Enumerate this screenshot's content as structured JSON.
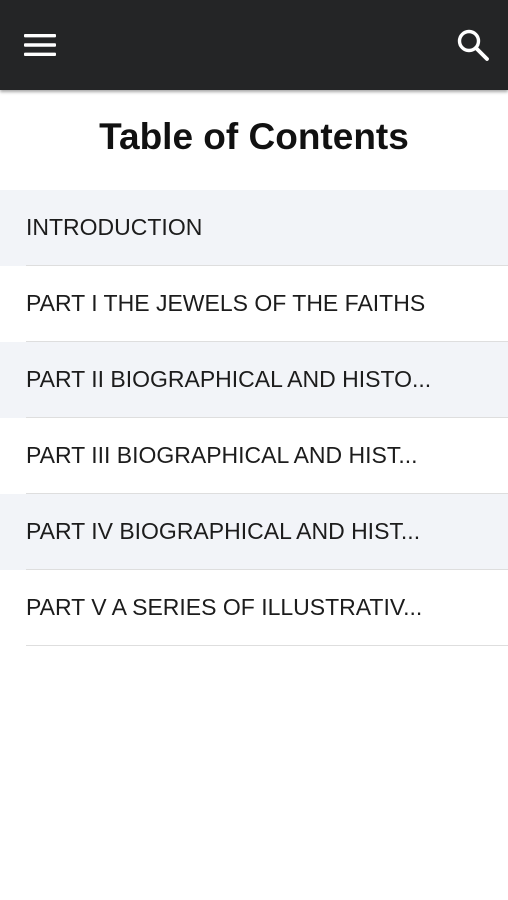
{
  "app_bar": {
    "background": "#242526",
    "menu_icon": "hamburger-menu-icon",
    "search_icon": "search-icon"
  },
  "page": {
    "title": "Table of Contents"
  },
  "toc": {
    "items": [
      {
        "label": "INTRODUCTION"
      },
      {
        "label": "PART I THE JEWELS OF THE FAITHS"
      },
      {
        "label": "PART II BIOGRAPHICAL AND HISTO..."
      },
      {
        "label": "PART III BIOGRAPHICAL AND HIST..."
      },
      {
        "label": "PART IV BIOGRAPHICAL AND HIST..."
      },
      {
        "label": "PART V A SERIES OF ILLUSTRATIV..."
      }
    ]
  }
}
